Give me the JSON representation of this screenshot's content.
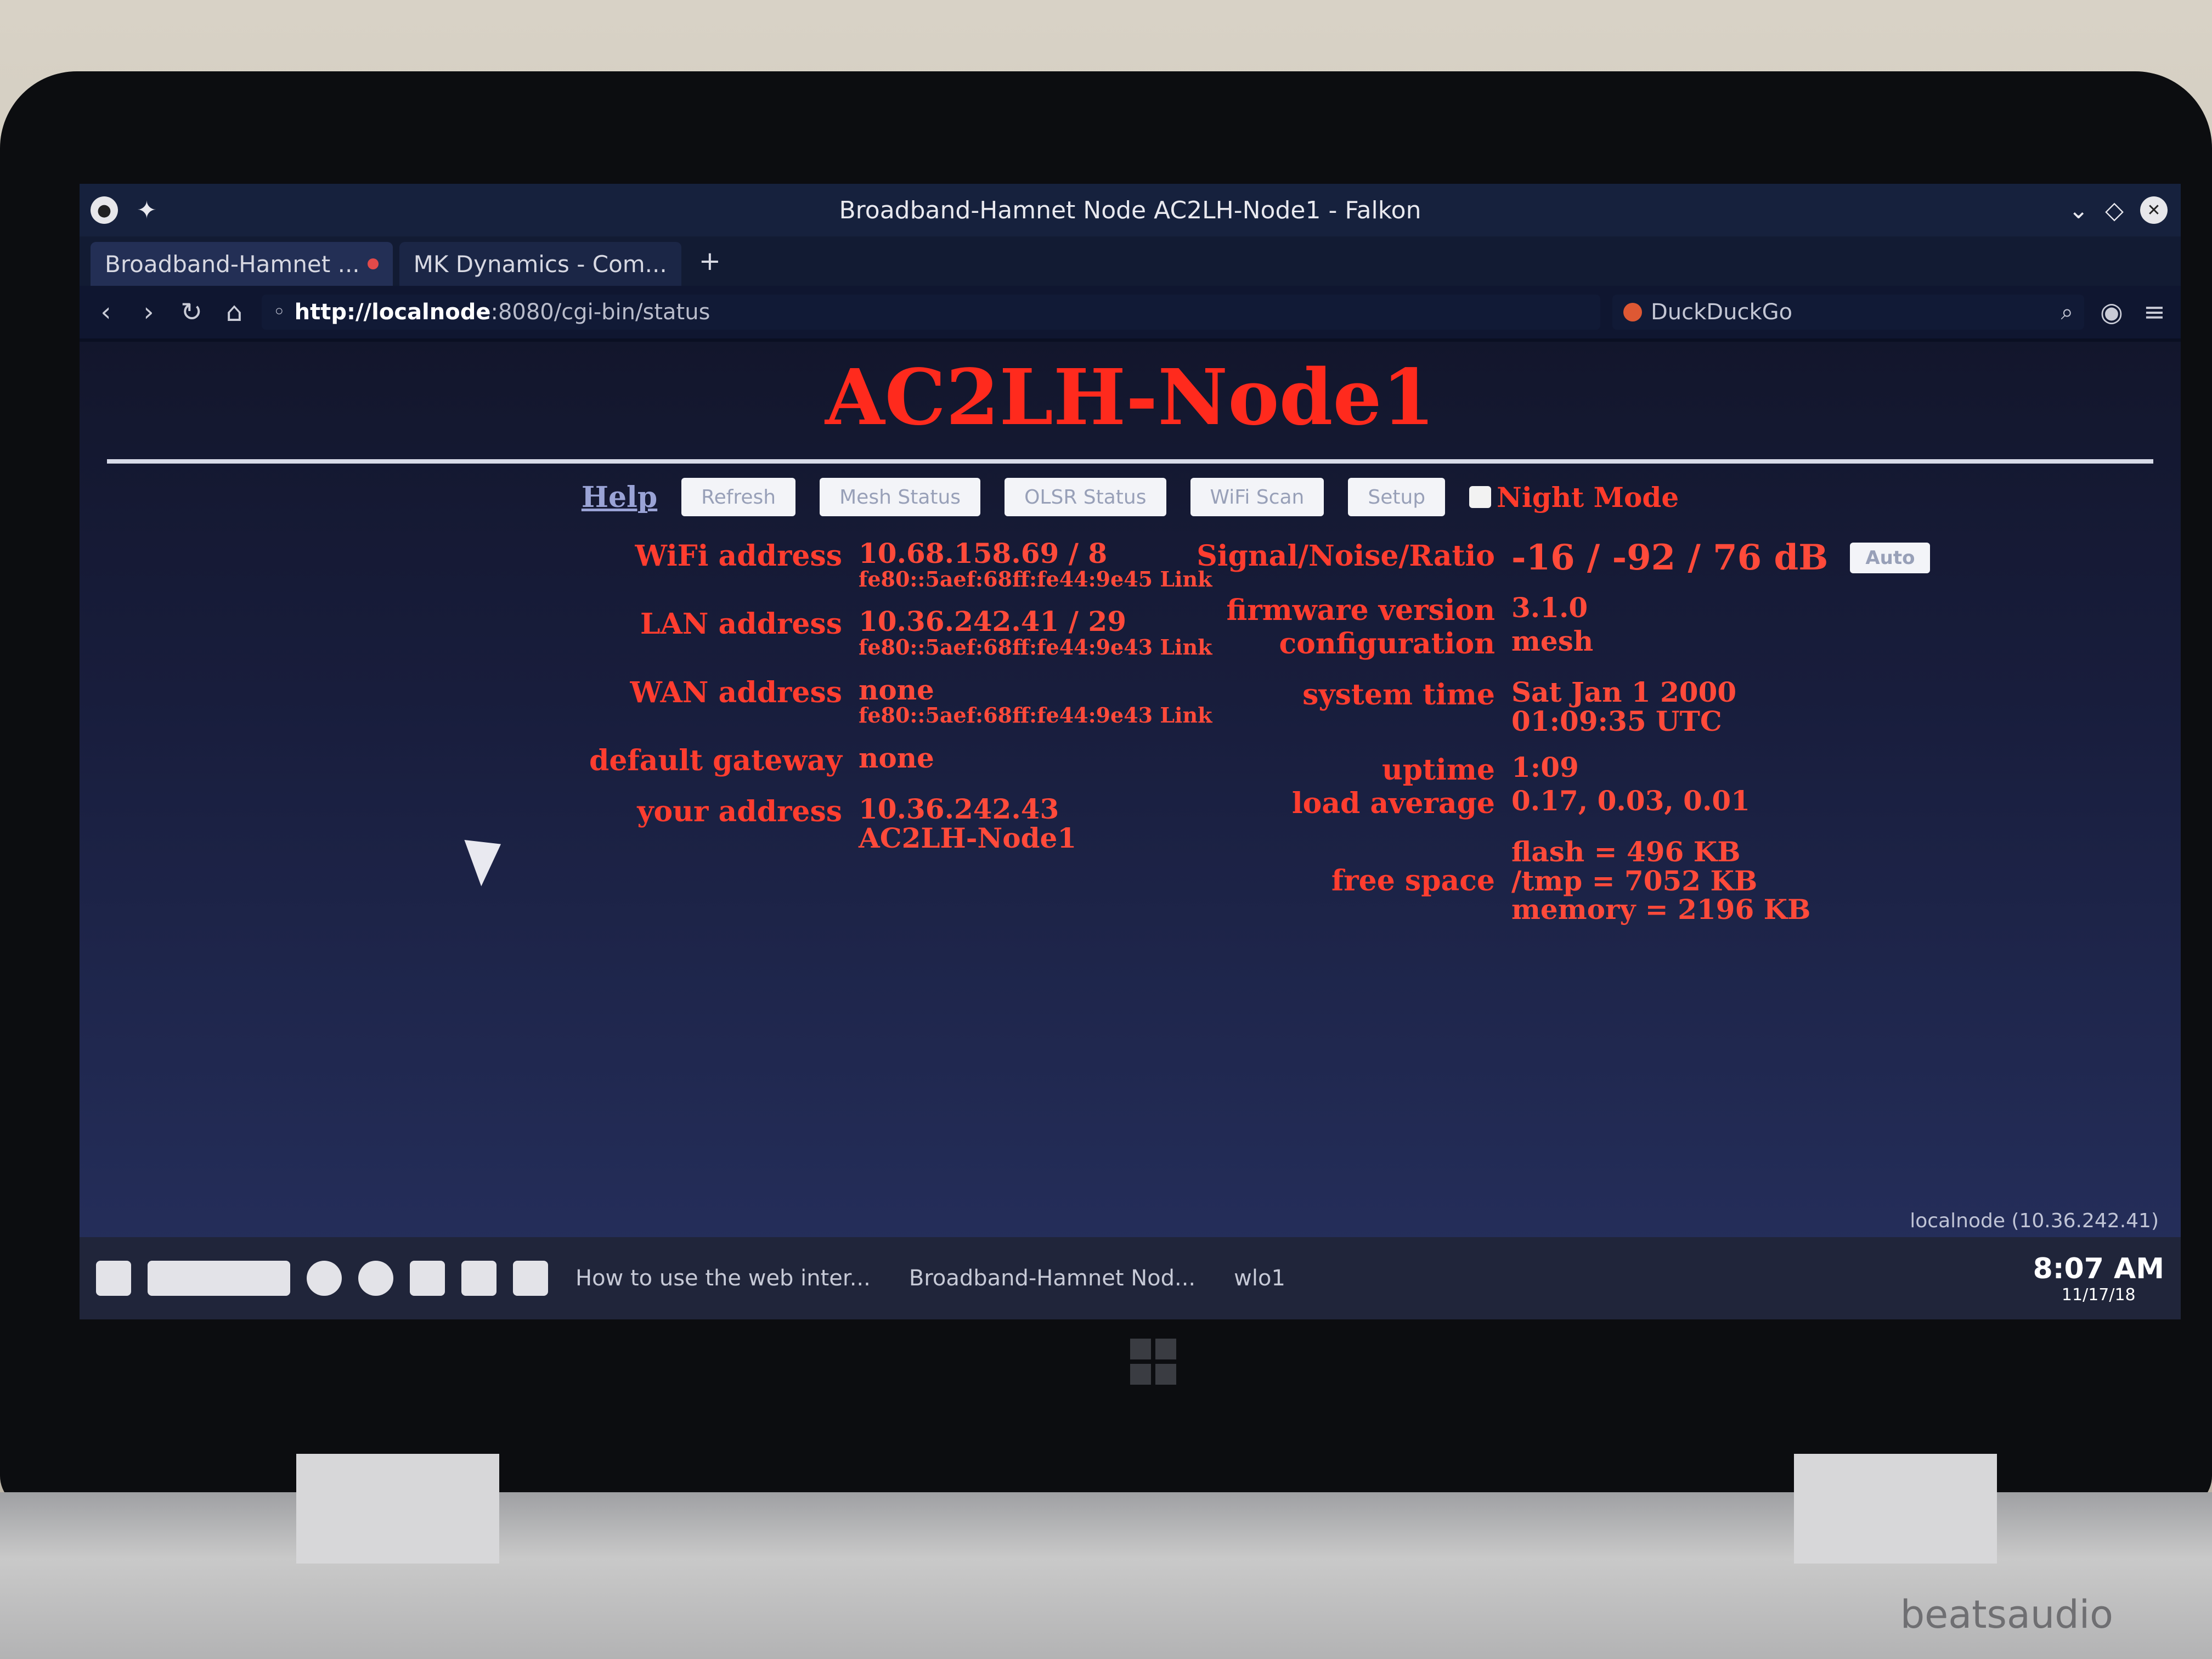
{
  "window": {
    "title": "Broadband-Hamnet Node AC2LH-Node1 - Falkon"
  },
  "tabs": [
    {
      "label": "Broadband-Hamnet ..."
    },
    {
      "label": "MK Dynamics - Com..."
    }
  ],
  "navbar": {
    "url_host": "http://localnode",
    "url_rest": ":8080/cgi-bin/status",
    "search_placeholder": "DuckDuckGo"
  },
  "page": {
    "node_title": "AC2LH-Node1",
    "help_label": "Help",
    "buttons": [
      "Refresh",
      "Mesh Status",
      "OLSR Status",
      "WiFi Scan",
      "Setup"
    ],
    "night_mode_label": "Night Mode",
    "left": {
      "wifi_label": "WiFi address",
      "wifi_value": "10.68.158.69 / 8",
      "wifi_link": "fe80::5aef:68ff:fe44:9e45 Link",
      "lan_label": "LAN address",
      "lan_value": "10.36.242.41 / 29",
      "lan_link": "fe80::5aef:68ff:fe44:9e43 Link",
      "wan_label": "WAN address",
      "wan_value": "none",
      "wan_link": "fe80::5aef:68ff:fe44:9e43 Link",
      "gateway_label": "default gateway",
      "gateway_value": "none",
      "your_label": "your address",
      "your_ip": "10.36.242.43",
      "your_host": "AC2LH-Node1"
    },
    "right": {
      "snr_label": "Signal/Noise/Ratio",
      "snr_value": "-16 / -92 / 76 dB",
      "auto_label": "Auto",
      "fw_label": "firmware version",
      "fw_value": "3.1.0",
      "config_label": "configuration",
      "config_value": "mesh",
      "time_label": "system time",
      "time_date": "Sat Jan 1 2000",
      "time_clock": "01:09:35 UTC",
      "uptime_label": "uptime",
      "uptime_value": "1:09",
      "load_label": "load average",
      "load_value": "0.17, 0.03, 0.01",
      "free_label": "free space",
      "flash": "flash = 496 KB",
      "tmp": "/tmp = 7052 KB",
      "memory": "memory = 2196 KB"
    }
  },
  "statusbar": {
    "text": "localnode (10.36.242.41)"
  },
  "taskbar": {
    "task1": "How to use the web inter...",
    "task2": "Broadband-Hamnet Nod...",
    "iface": "wlo1",
    "time": "8:07 AM",
    "date": "11/17/18"
  },
  "device": {
    "brand": "beatsaudio"
  }
}
